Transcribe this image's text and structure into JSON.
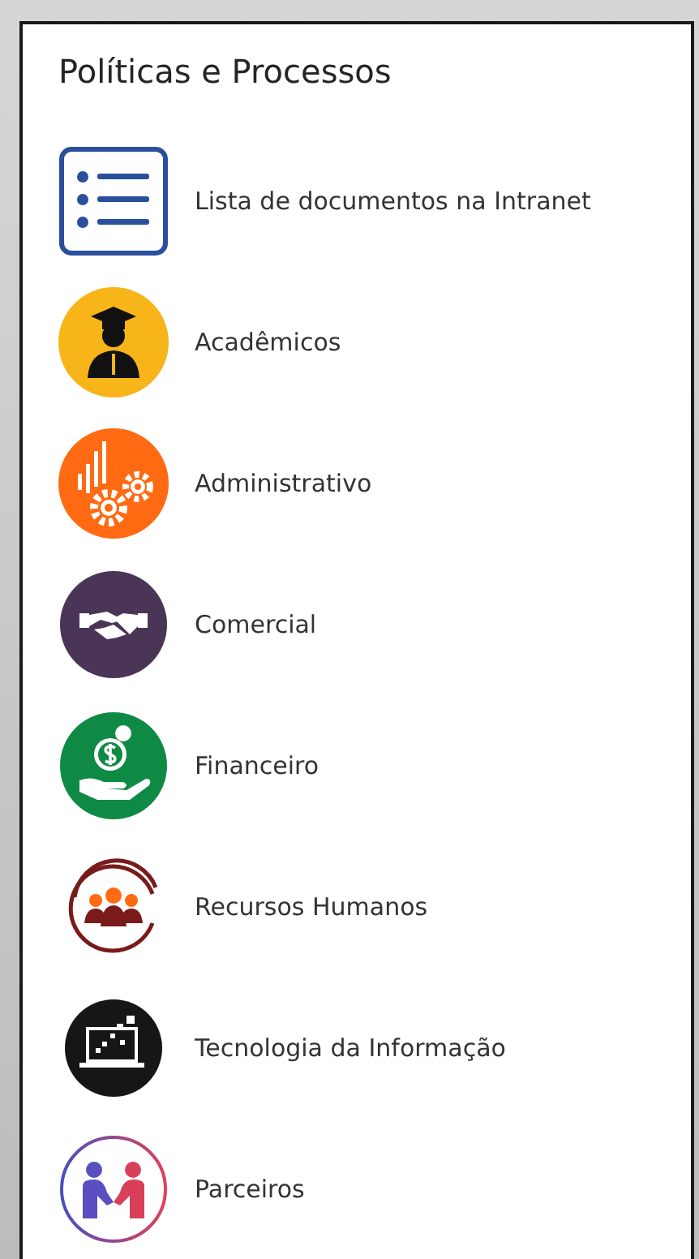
{
  "panel": {
    "title": "Políticas e Processos",
    "items": [
      {
        "kind": "list",
        "label": "Lista de documentos na Intranet"
      },
      {
        "kind": "graduate",
        "label": "Acadêmicos"
      },
      {
        "kind": "gears",
        "label": "Administrativo"
      },
      {
        "kind": "handshake",
        "label": "Comercial"
      },
      {
        "kind": "money",
        "label": "Financeiro"
      },
      {
        "kind": "team",
        "label": "Recursos Humanos"
      },
      {
        "kind": "laptop",
        "label": "Tecnologia da Informação"
      },
      {
        "kind": "partners",
        "label": "Parceiros"
      }
    ]
  }
}
